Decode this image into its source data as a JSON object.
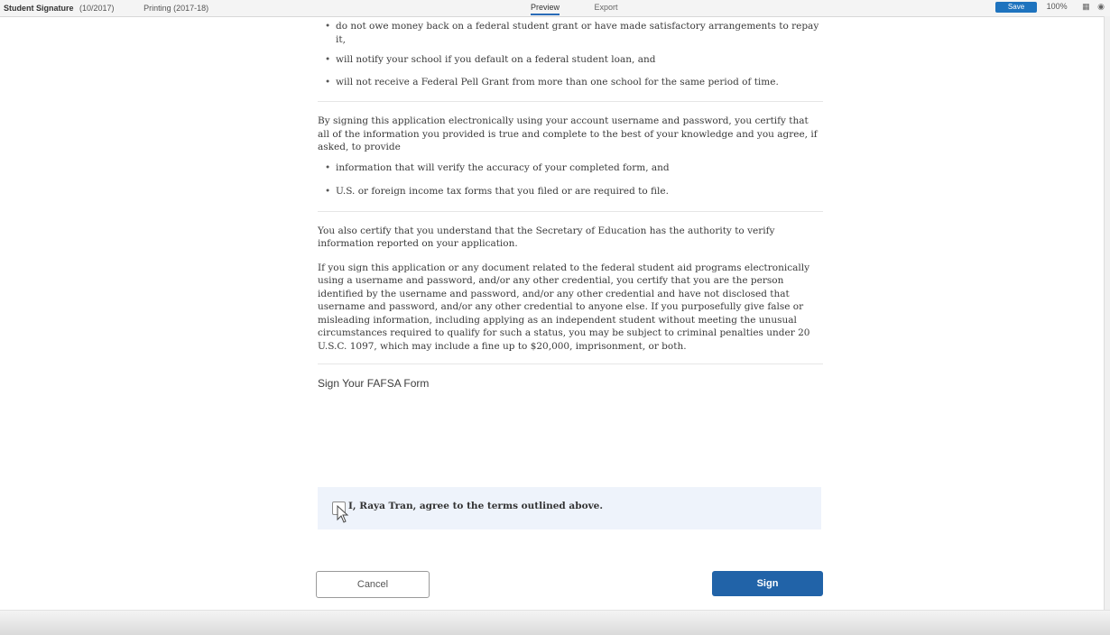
{
  "toolbar": {
    "doc_title": "Student Signature",
    "doc_sub": "(10/2017)",
    "section": "Printing (2017-18)",
    "tabs": [
      "Preview",
      "Export"
    ],
    "save_label": "Save",
    "zoom": "100%",
    "icon_grid": "grid-icon",
    "icon_user": "user-icon"
  },
  "document": {
    "bullets_top": [
      "do not owe money back on a federal student grant or have made satisfactory arrangements to repay it,",
      "will notify your school if you default on a federal student loan, and",
      "will not receive a Federal Pell Grant from more than one school for the same period of time."
    ],
    "para1": "By signing this application electronically using your account username and password, you certify that all of the information you provided is true and complete to the best of your knowledge and you agree, if asked, to provide",
    "bullets_mid": [
      "information that will verify the accuracy of your completed form, and",
      "U.S. or foreign income tax forms that you filed or are required to file."
    ],
    "para2": "You also certify that you understand that the Secretary of Education has the authority to verify information reported on your application.",
    "para3": "If you sign this application or any document related to the federal student aid programs electronically using a username and password, and/or any other credential, you certify that you are the person identified by the username and password, and/or any other credential and have not disclosed that username and password, and/or any other credential to anyone else. If you purposefully give false or misleading information, including applying as an independent student without meeting the unusual circumstances required to qualify for such a status, you may be subject to criminal penalties under 20 U.S.C. 1097, which may include a fine up to $20,000, imprisonment, or both."
  },
  "sign": {
    "heading": "Sign Your FAFSA Form",
    "agree_label": "I, Raya Tran, agree to the terms outlined above.",
    "checked": false
  },
  "buttons": {
    "cancel": "Cancel",
    "sign": "Sign"
  },
  "colors": {
    "accent": "#2163a8",
    "agree_bg": "#eef3fb"
  }
}
